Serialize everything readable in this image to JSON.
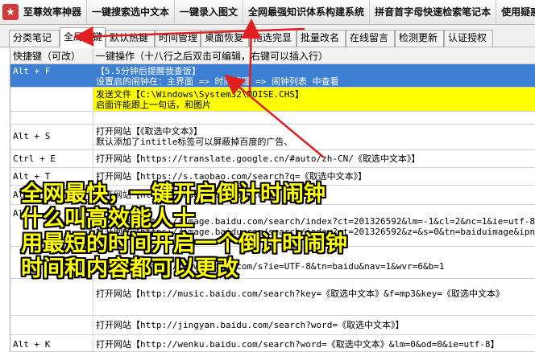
{
  "toolbar": {
    "items": [
      {
        "label": "至尊效率神器"
      },
      {
        "label": "一键搜索选中文本"
      },
      {
        "label": "一键录入图文"
      },
      {
        "label": "全网最强知识体系构建系统"
      },
      {
        "label": "拼音首字母快速检索笔记本"
      },
      {
        "label": "使用疑惑"
      }
    ]
  },
  "tabs": [
    {
      "label": "分类笔记"
    },
    {
      "label": "全局热键"
    },
    {
      "label": "默认热键"
    },
    {
      "label": "时间管理"
    },
    {
      "label": "桌面恢复"
    },
    {
      "label": "拖选完显"
    },
    {
      "label": "批量改名"
    },
    {
      "label": "在线留言"
    },
    {
      "label": "检测更新"
    },
    {
      "label": "认证授权"
    }
  ],
  "grid": {
    "headers": [
      "快捷键（可改）",
      "一键操作（十八行之后双击可编辑，右键可以插入行）"
    ],
    "rows": [
      {
        "key": "Alt + F",
        "lines": [
          "【5.5分钟后提醒我查饭】",
          "设置启的闹钟在：主界面 => 时间管理 => 闹钟列表 中查看"
        ],
        "selected": true
      },
      {
        "key": "",
        "lines": [
          "发送文件【C:\\Windows\\System32\\NOISE.CHS】",
          "启面许能跟上一句话，和图片"
        ],
        "highlight": true
      },
      {
        "key": "",
        "lines": [
          ""
        ]
      },
      {
        "key": "Alt + S",
        "lines": [
          "打开网站【《取选中文本》】",
          "默认添加了intitle标签可以屏蔽掉百度的广告、"
        ]
      },
      {
        "key": "Ctrl + E",
        "lines": [
          "打开网站【https://translate.google.cn/#auto/zh-CN/《取选中文本》】"
        ]
      },
      {
        "key": "Alt + T",
        "lines": [
          "打开网站【https://s.taobao.com/search?q=《取选中文本》】"
        ]
      },
      {
        "key": "Alt + ",
        "lines": [
          "打开网站【https://haokan.baidu.com/"
        ]
      },
      {
        "key": "Alt + ",
        "lines": [
          "打开网站【https://image.baidu.com/search/index?ct=201326592&lm=-1&cl=2&nc=1&ie=utf-8",
          "打开网站【https://image.baidu.com/search/index?ct=201326592&z=&s=0&tn=baiduimage&ipn=r&word="
        ]
      },
      {
        "key": "",
        "lines": [
          "打开网站【https://www.baidu.com/s?ie=UTF-8&tn=baidu&nav=1&wvr=6&b=1"
        ]
      },
      {
        "key": "",
        "lines": [
          "打开网站【http://music.baidu.com/search?key=《取选中文本》&f=mp3&key=《取选中文本》"
        ]
      },
      {
        "key": "",
        "lines": [
          "打开网站【http://jingyan.baidu.com/search?word=《取选中文本》】"
        ]
      },
      {
        "key": "Alt + K",
        "lines": [
          "打开网站【http://wenku.baidu.com/search?word=《取选中文本》&lm=0&od=0&ie=utf-8】"
        ]
      }
    ]
  },
  "overlay": {
    "lines": [
      "全网最快，一键开启倒计时闹钟",
      "什么叫高效能人士",
      "用最短的时间开启一个倒计时闹钟",
      "时间和内容都可以更改"
    ]
  },
  "colors": {
    "selection": "#3d7fd3",
    "highlight": "#ffff00",
    "caption": "#ffff00",
    "arrow": "#e02020"
  },
  "icons": {
    "app_logo": "app-logo-icon"
  }
}
